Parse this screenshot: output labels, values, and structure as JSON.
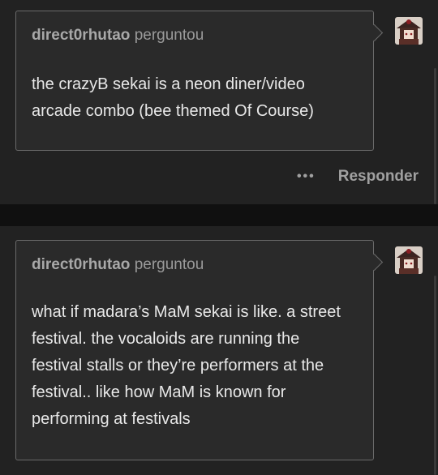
{
  "posts": [
    {
      "asker": "direct0rhutao",
      "verb": "perguntou",
      "question": "the crazyB sekai is a neon diner/video arcade combo (bee themed Of Course)",
      "more_icon": "more-dots-icon",
      "reply_label": "Responder"
    },
    {
      "asker": "direct0rhutao",
      "verb": "perguntou",
      "question": "what if madara’s MaM sekai is like. a street festival. the vocaloids are running the festival stalls or they’re performers at the festival.. like how MaM is known for performing at festivals"
    }
  ]
}
